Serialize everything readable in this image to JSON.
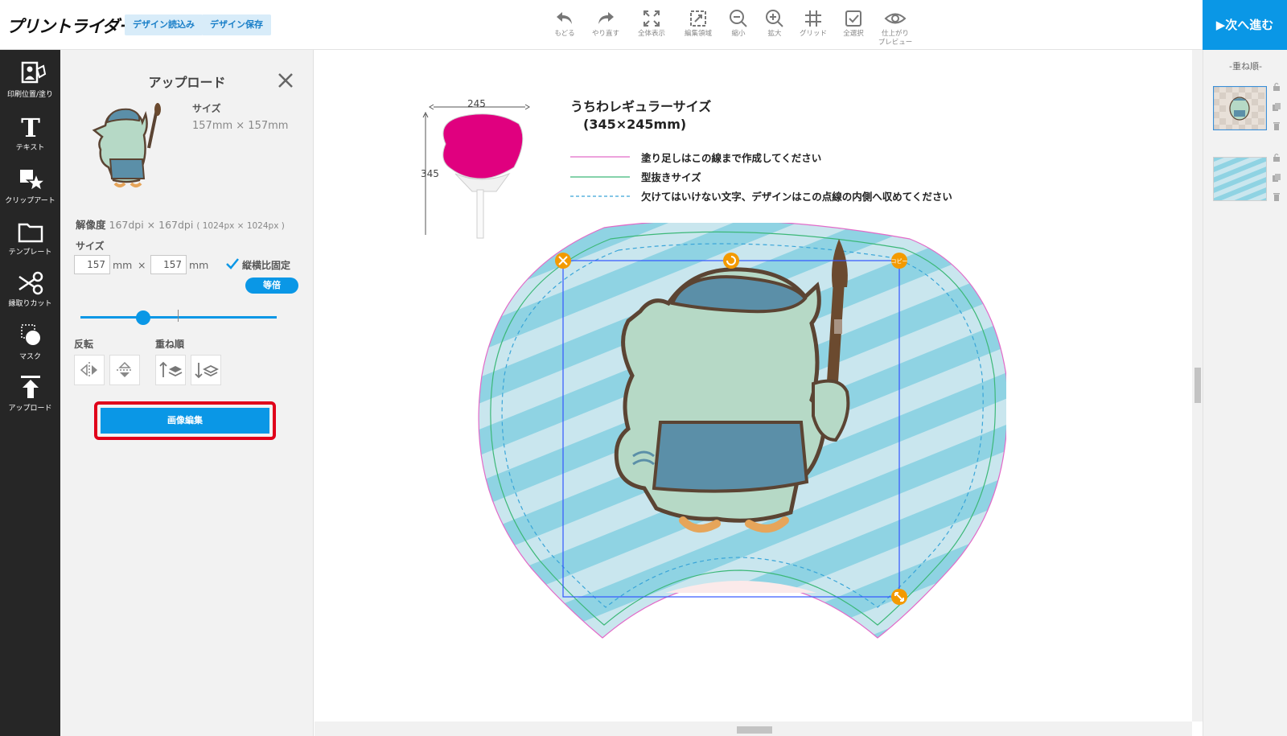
{
  "header": {
    "logo": "プリントライダー",
    "load_design": "デザイン読込み",
    "save_design": "デザイン保存",
    "next": "▶次へ進む",
    "tools": [
      {
        "label": "もどる",
        "icon": "undo-icon"
      },
      {
        "label": "やり直す",
        "icon": "redo-icon"
      },
      {
        "label": "全体表示",
        "icon": "fit-view-icon"
      },
      {
        "label": "編集領域",
        "icon": "edit-area-icon"
      },
      {
        "label": "縮小",
        "icon": "zoom-out-icon"
      },
      {
        "label": "拡大",
        "icon": "zoom-in-icon"
      },
      {
        "label": "グリッド",
        "icon": "grid-icon"
      },
      {
        "label": "全選択",
        "icon": "select-all-icon"
      },
      {
        "label": "仕上がり",
        "label2": "プレビュー",
        "icon": "preview-eye-icon"
      }
    ]
  },
  "sidebar": {
    "items": [
      {
        "label": "印刷位置/塗り",
        "icon": "print-position-icon"
      },
      {
        "label": "テキスト",
        "icon": "text-icon"
      },
      {
        "label": "クリップアート",
        "icon": "clipart-icon"
      },
      {
        "label": "テンプレート",
        "icon": "template-folder-icon"
      },
      {
        "label": "縁取りカット",
        "icon": "scissors-icon"
      },
      {
        "label": "マスク",
        "icon": "mask-icon"
      },
      {
        "label": "アップロード",
        "icon": "upload-icon"
      }
    ]
  },
  "panel": {
    "title": "アップロード",
    "size_label": "サイズ",
    "size_value": "157mm × 157mm",
    "resolution_label": "解像度",
    "resolution_value": "167dpi × 167dpi",
    "resolution_px": "( 1024px × 1024px )",
    "size_section_label": "サイズ",
    "width_value": "157",
    "height_value": "157",
    "unit": "mm",
    "times": "×",
    "keep_ratio_label": "縦横比固定",
    "keep_ratio_checked": true,
    "actual_size_button": "等倍",
    "scale_slider_value": 0.32,
    "flip_label": "反転",
    "order_label": "重ね順",
    "edit_image_button": "画像編集"
  },
  "canvas": {
    "spec_title_line1": "うちわレギュラーサイズ",
    "spec_title_line2": "(345×245mm)",
    "dim_width": "245",
    "dim_height": "345",
    "legend": [
      {
        "text": "塗り足しはこの線まで作成してください",
        "color": "#e26ac8",
        "style": "solid"
      },
      {
        "text": "型抜きサイズ",
        "color": "#3cb878",
        "style": "solid"
      },
      {
        "text": "欠けてはいけない文字、デザインはこの点線の内側へ収めてください",
        "color": "#3aa5d8",
        "style": "dashed"
      }
    ],
    "handle_copy_label": "コピー",
    "fan_color": "#e0007f",
    "stripe_color": "#8fd3e3",
    "selection_color": "#3355ff",
    "handle_color": "#f39a00"
  },
  "layers": {
    "title": "-重ね順-"
  }
}
